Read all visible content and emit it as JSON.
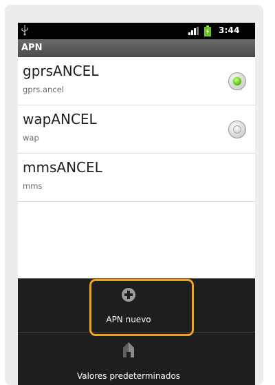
{
  "status_bar": {
    "time": "3:44",
    "icons": [
      "usb-icon",
      "signal-icon",
      "battery-icon"
    ]
  },
  "title_bar": {
    "title": "APN"
  },
  "apn_list": [
    {
      "name": "gprsANCEL",
      "apn": "gprs.ancel",
      "selected": true
    },
    {
      "name": "wapANCEL",
      "apn": "wap",
      "selected": false
    },
    {
      "name": "mmsANCEL",
      "apn": "mms",
      "selected": null
    }
  ],
  "menu": {
    "new_apn_label": "APN nuevo",
    "new_apn_icon": "plus-icon",
    "reset_label": "Valores predeterminados",
    "reset_icon": "reset-icon"
  },
  "colors": {
    "highlight": "#f2a31b",
    "radio_selected": "#61c21c",
    "title_bar": "#5a5a5a"
  }
}
